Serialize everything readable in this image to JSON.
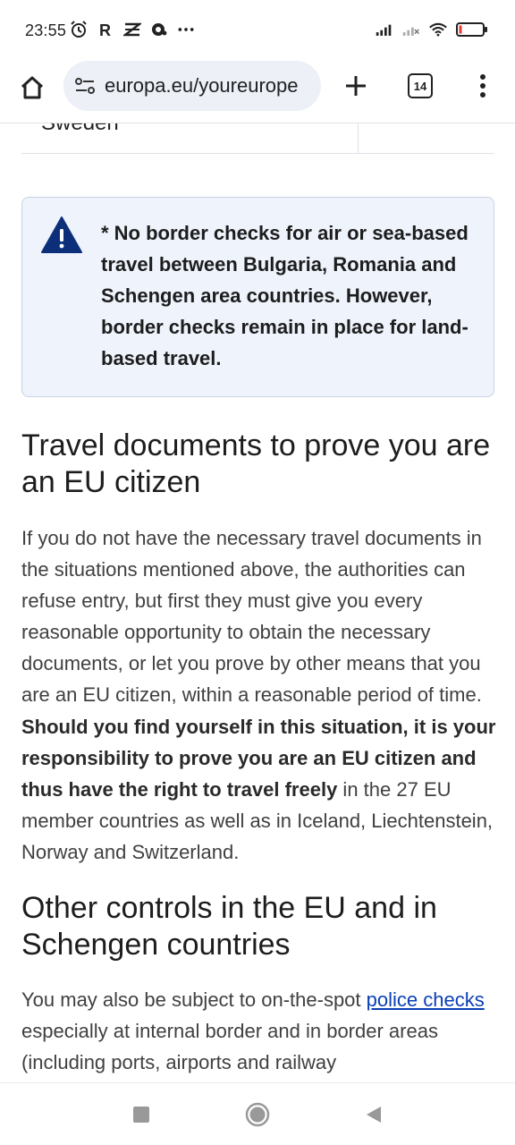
{
  "status_bar": {
    "time": "23:55",
    "battery": "11",
    "icons": [
      "alarm-icon",
      "r-app-icon",
      "app-icon",
      "chat-icon",
      "more-dots-icon",
      "signal-icon",
      "signal-no-service-icon",
      "wifi-icon",
      "battery-icon"
    ]
  },
  "browser": {
    "url": "europa.eu/youreurope",
    "tab_count": "14"
  },
  "table_remnant": {
    "cell": "Sweden"
  },
  "notice": {
    "text": "* No border checks for air or sea-based travel between Bulgaria, Romania and Schengen area countries. However, border checks remain in place for land-based travel."
  },
  "section1": {
    "title": "Travel documents to prove you are an EU citizen",
    "para_part1": "If you do not have the necessary travel documents in the situations mentioned above, the authorities can refuse entry, but first they must give you every reasonable opportunity to obtain the necessary documents, or let you prove by other means that you are an EU citizen, within a reasonable period of time. ",
    "para_bold": "Should you find yourself in this situation, it is your responsibility to prove you are an EU citizen and thus have the right to travel freely",
    "para_part2": " in the 27 EU member countries as well as in Iceland, Liechtenstein, Norway and Switzerland."
  },
  "section2": {
    "title": "Other controls in the EU and in Schengen countries",
    "para_part1": "You may also be subject to on-the-spot ",
    "link": "police checks",
    "para_part2": " especially at internal border and in border areas (including ports, airports and railway"
  },
  "colors": {
    "link": "#0b3fb5",
    "notice_bg": "#eef3fc",
    "warning_icon": "#0d2f7a"
  }
}
